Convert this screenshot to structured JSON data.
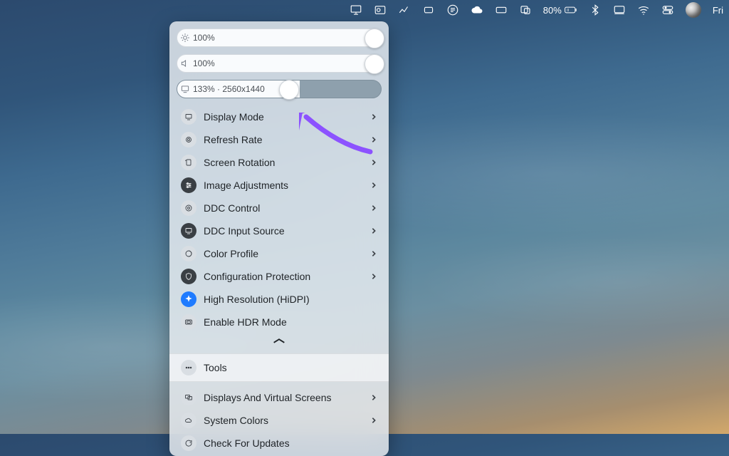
{
  "menubar": {
    "battery_text": "80%",
    "clock_text": "Fri "
  },
  "panel": {
    "sliders": {
      "brightness": {
        "label": "100%",
        "pos_pct": 92
      },
      "volume": {
        "label": "100%",
        "pos_pct": 92
      },
      "resolution": {
        "label": "133% · 2560x1440",
        "fill_pct": 60,
        "pos_pct": 50
      }
    },
    "items": [
      {
        "label": "Display Mode",
        "chevron": true,
        "icon": "display"
      },
      {
        "label": "Refresh Rate",
        "chevron": true,
        "icon": "refresh"
      },
      {
        "label": "Screen Rotation",
        "chevron": true,
        "icon": "rotate"
      },
      {
        "label": "Image Adjustments",
        "chevron": true,
        "icon": "adjust",
        "dark": true
      },
      {
        "label": "DDC Control",
        "chevron": true,
        "icon": "ddc"
      },
      {
        "label": "DDC Input Source",
        "chevron": true,
        "icon": "input",
        "dark": true
      },
      {
        "label": "Color Profile",
        "chevron": true,
        "icon": "color"
      },
      {
        "label": "Configuration Protection",
        "chevron": true,
        "icon": "shield",
        "dark": true
      },
      {
        "label": "High Resolution (HiDPI)",
        "chevron": false,
        "icon": "sparkle",
        "blue": true
      },
      {
        "label": "Enable HDR Mode",
        "chevron": false,
        "icon": "hdr"
      }
    ],
    "tools_label": "Tools",
    "secondary": [
      {
        "label": "Displays And Virtual Screens",
        "chevron": true,
        "icon": "screens"
      },
      {
        "label": "System Colors",
        "chevron": true,
        "icon": "cloud"
      },
      {
        "label": "Check For Updates",
        "chevron": false,
        "icon": "reload"
      }
    ]
  }
}
